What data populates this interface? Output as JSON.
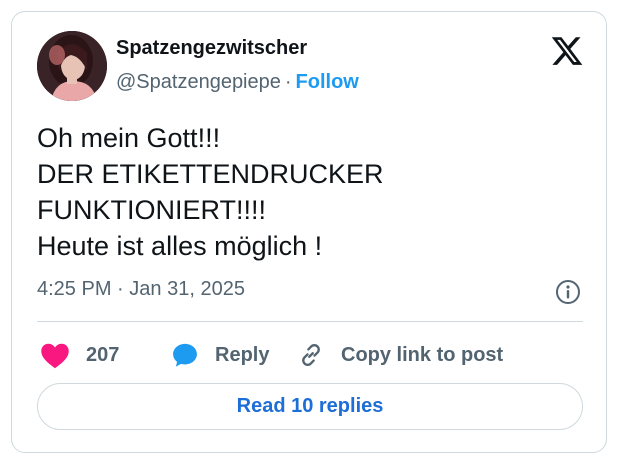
{
  "author": {
    "display_name": "Spatzengezwitscher",
    "handle": "@Spatzengepiepe",
    "separator": "·",
    "follow_label": "Follow"
  },
  "tweet": {
    "lines": [
      "Oh mein Gott!!!",
      "DER ETIKETTENDRUCKER",
      "FUNKTIONIERT!!!!",
      "Heute ist alles möglich !"
    ],
    "time": "4:25 PM",
    "date_separator": "·",
    "date": "Jan 31, 2025"
  },
  "actions": {
    "like_count": "207",
    "reply_label": "Reply",
    "copy_label": "Copy link to post"
  },
  "read_replies_label": "Read 10 replies",
  "icons": {
    "platform": "x-logo-icon",
    "info": "info-icon",
    "like": "heart-icon",
    "reply": "speech-bubble-icon",
    "copy": "link-icon"
  },
  "colors": {
    "like": "#f91880",
    "reply": "#1d9bf0",
    "follow": "#1d9bf0",
    "read_replies": "#1d6ed6",
    "muted": "#536471",
    "border": "#cfd9de"
  }
}
